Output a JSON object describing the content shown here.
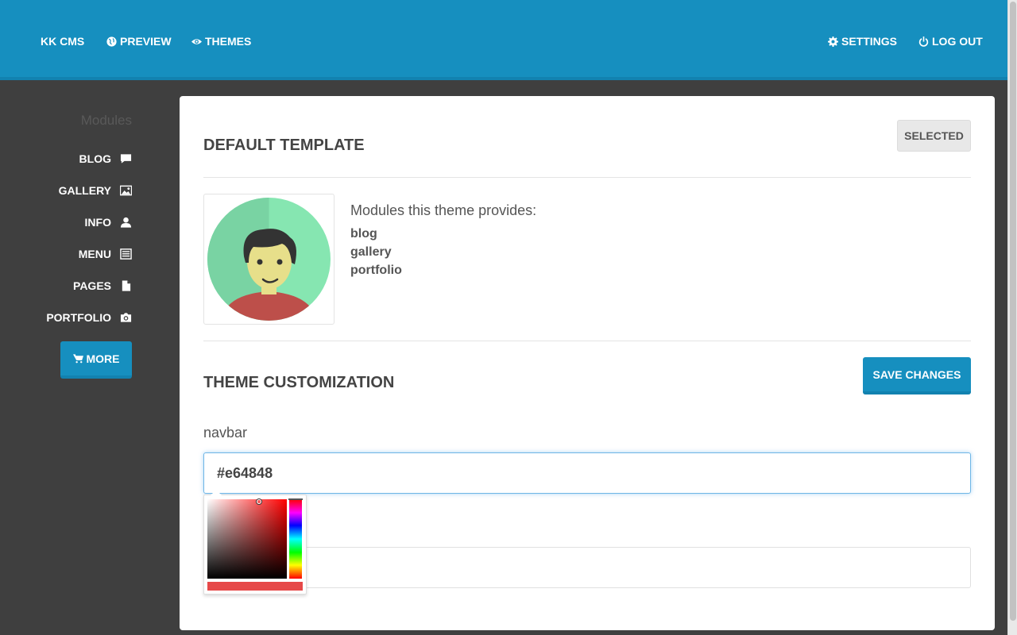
{
  "navbar": {
    "brand": "KK CMS",
    "preview": "PREVIEW",
    "themes": "THEMES",
    "settings": "SETTINGS",
    "logout": "LOG OUT"
  },
  "sidebar": {
    "title": "Modules",
    "items": [
      {
        "label": "BLOG",
        "icon": "comment-icon"
      },
      {
        "label": "GALLERY",
        "icon": "picture-icon"
      },
      {
        "label": "INFO",
        "icon": "user-icon"
      },
      {
        "label": "MENU",
        "icon": "list-icon"
      },
      {
        "label": "PAGES",
        "icon": "file-icon"
      },
      {
        "label": "PORTFOLIO",
        "icon": "camera-icon"
      }
    ],
    "more_label": "MORE"
  },
  "template": {
    "title": "DEFAULT TEMPLATE",
    "status": "SELECTED",
    "provides_label": "Modules this theme provides:",
    "modules": [
      "blog",
      "gallery",
      "portfolio"
    ]
  },
  "customization": {
    "title": "THEME CUSTOMIZATION",
    "save_label": "SAVE CHANGES",
    "field_label": "navbar",
    "field_value": "#e64848"
  },
  "colors": {
    "accent": "#168fbf",
    "sidebar_bg": "#3f3f3f",
    "picked": "#e64848"
  }
}
